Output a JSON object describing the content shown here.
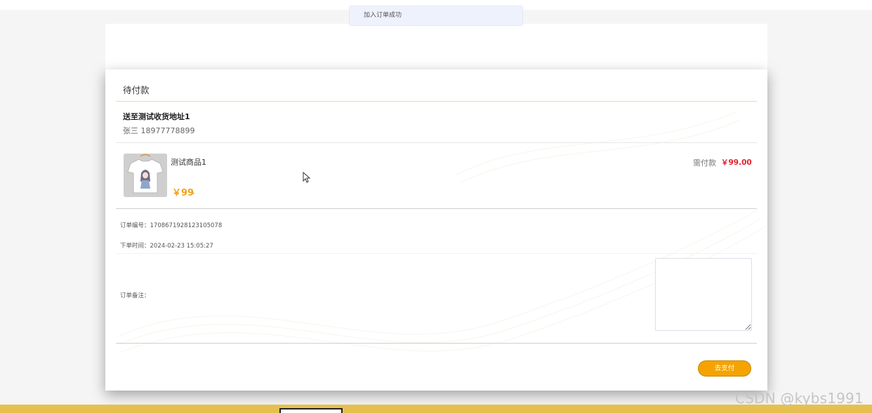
{
  "toast": {
    "message": "加入订单成功"
  },
  "dialog": {
    "title": "待付款",
    "address": {
      "name": "送至测试收货地址1",
      "contact": "张三 18977778899"
    },
    "item": {
      "name": "测试商品1",
      "price": "￥99",
      "qty_mark": "ₓ",
      "image_icon": "tshirt-product-image"
    },
    "payment": {
      "label": "需付款",
      "amount": "￥99.00"
    },
    "order_number": "订单编号：1708671928123105078",
    "order_time": "下单时间：2024-02-23 15:05:27",
    "remark_label": "订单备注：",
    "remark_value": "",
    "pay_button": "去支付"
  },
  "watermark": "CSDN @kybs1991",
  "colors": {
    "accent": "#f5a300",
    "price": "#f0a21a",
    "amount": "#e4222b",
    "bottom_strip": "#e6c04f"
  }
}
